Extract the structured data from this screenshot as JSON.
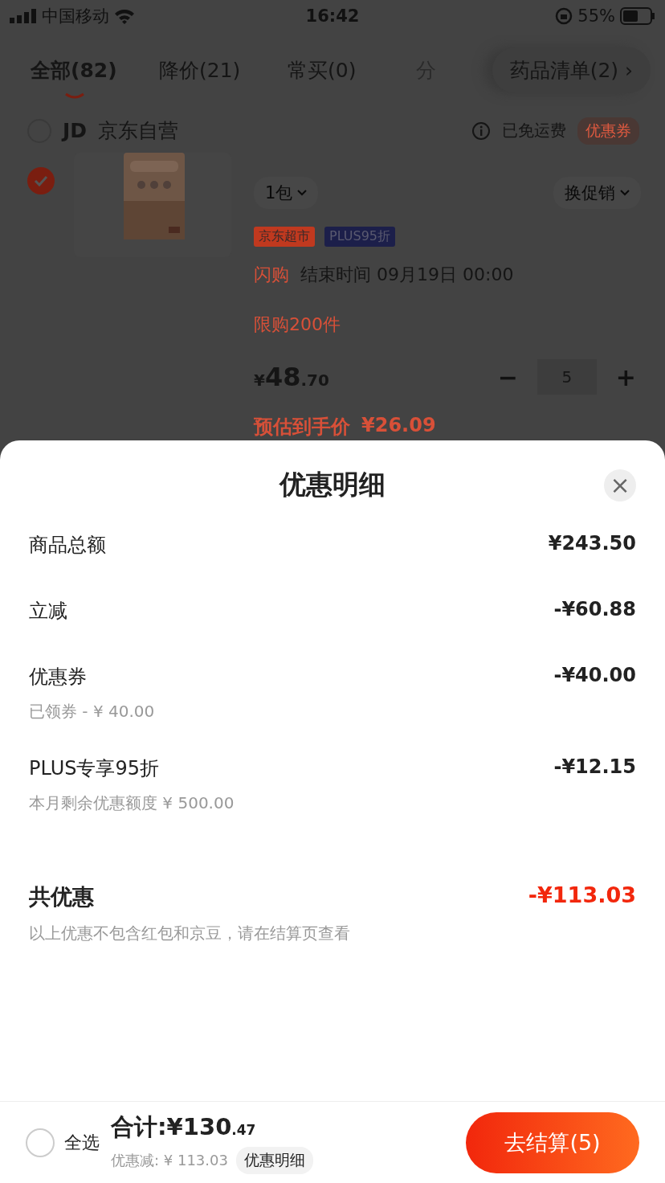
{
  "status_bar": {
    "carrier": "中国移动",
    "time": "16:42",
    "battery": "55%"
  },
  "tabs": [
    {
      "label": "全部(82)",
      "selected": true
    },
    {
      "label": "降价(21)",
      "selected": false
    },
    {
      "label": "常买(0)",
      "selected": false
    },
    {
      "label": "分",
      "selected": false
    }
  ],
  "list_button": {
    "label": "药品清单(2)",
    "arrow": "›"
  },
  "store": {
    "checked": false,
    "logo": "JD",
    "name": "京东自营",
    "shipping": "已免运费",
    "coupon": "优惠券"
  },
  "product": {
    "checked": true,
    "spec": "1包",
    "promo": "换促销",
    "tags": [
      {
        "label": "京东超市",
        "color": "#c0391f"
      },
      {
        "label": "PLUS95折",
        "color": "#1c1f4a"
      }
    ],
    "flash_label": "闪购",
    "flash_end": "结束时间 09月19日 00:00",
    "limit": "限购200件",
    "price_symbol": "¥",
    "price_int": "48",
    "price_dec": ".70",
    "minus": "−",
    "quantity": "5",
    "plus": "+",
    "estimate_label": "预估到手价",
    "estimate": "¥26.09"
  },
  "sheet": {
    "title": "优惠明细",
    "close": "×",
    "rows": [
      {
        "label": "商品总额",
        "amount": "¥243.50"
      },
      {
        "label": "立减",
        "amount": "-¥60.88"
      },
      {
        "label": "优惠券",
        "amount": "-¥40.00",
        "note": "已领券 - ¥ 40.00"
      },
      {
        "label": "PLUS专享95折",
        "amount": "-¥12.15",
        "note": "本月剩余优惠额度 ¥ 500.00"
      }
    ],
    "total": {
      "label": "共优惠",
      "amount": "-¥113.03",
      "note": "以上优惠不包含红包和京豆，请在结算页查看"
    }
  },
  "bottom_bar": {
    "select_all_checked": false,
    "select_all": "全选",
    "total_label": "合计:",
    "total_int": "¥130",
    "total_dec": ".47",
    "discount": "优惠减: ¥ 113.03",
    "detail_button": "优惠明细",
    "checkout": "去结算(5)"
  }
}
